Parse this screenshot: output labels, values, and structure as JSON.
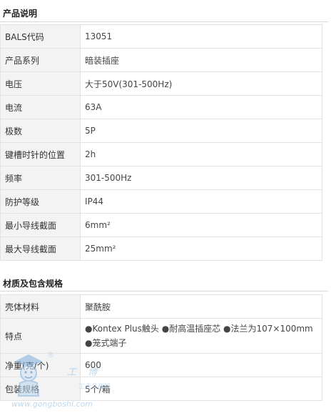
{
  "product": {
    "title": "产品说明",
    "rows": [
      {
        "key": "BALS代码",
        "value": "13051"
      },
      {
        "key": "产品系列",
        "value": "暗装插座"
      },
      {
        "key": "电压",
        "value": "大于50V(301-500Hz)"
      },
      {
        "key": "电流",
        "value": "63A"
      },
      {
        "key": "极数",
        "value": "5P"
      },
      {
        "key": "键槽时针的位置",
        "value": "2h"
      },
      {
        "key": "频率",
        "value": "301-500Hz"
      },
      {
        "key": "防护等级",
        "value": "IP44"
      },
      {
        "key": "最小导线截面",
        "value": "6mm²"
      },
      {
        "key": "最大导线截面",
        "value": "25mm²"
      }
    ]
  },
  "material": {
    "title": "材质及包含规格",
    "rows": [
      {
        "key": "壳体材料",
        "value": "聚酰胺"
      },
      {
        "key": "特点",
        "value": "●Kontex Plus触头 ●耐高温插座芯 ●法兰为107×100mm ●笼式端子"
      },
      {
        "key": "净重(克/个)",
        "value": "600"
      },
      {
        "key": "包装规格",
        "value": "5个/箱"
      }
    ]
  },
  "watermark": {
    "brand_cn": "工 博",
    "sub": "工业品商城",
    "url": "www.gongboshi.com",
    "reg": "®",
    "color": "#9ac3e6"
  }
}
